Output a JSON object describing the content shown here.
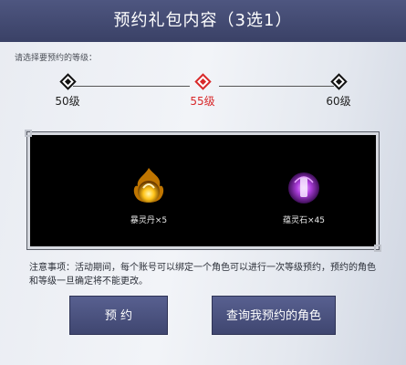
{
  "header": {
    "title": "预约礼包内容（3选1）"
  },
  "instruction": "请选择要预约的等级：",
  "levels": [
    {
      "label": "50级",
      "selected": false
    },
    {
      "label": "55级",
      "selected": true
    },
    {
      "label": "60级",
      "selected": false
    }
  ],
  "rewards": [
    {
      "name": "暴灵丹×5",
      "icon": "golden-flame-orb-icon"
    },
    {
      "name": "蕴灵石×45",
      "icon": "purple-spirit-stone-icon"
    }
  ],
  "notice": "注意事项：活动期间，每个账号可以绑定一个角色可以进行一次等级预约，预约的角色和等级一旦确定将不能更改。",
  "buttons": {
    "reserve": "预  约",
    "query": "查询我预约的角色"
  },
  "colors": {
    "header": "#444b73",
    "accent": "#d8282a",
    "button": "#4b5280"
  }
}
